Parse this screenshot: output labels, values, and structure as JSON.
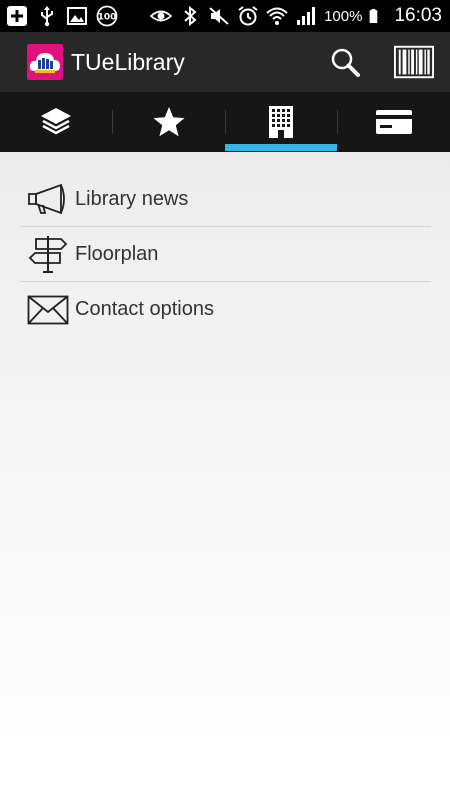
{
  "status_bar": {
    "battery_percent": "100%",
    "time": "16:03",
    "icons_left": [
      "add-icon",
      "usb-icon",
      "image-icon",
      "100-badge-icon"
    ],
    "icons_right": [
      "eye-icon",
      "bluetooth-icon",
      "mute-icon",
      "alarm-icon",
      "wifi-icon",
      "signal-icon",
      "battery-icon"
    ]
  },
  "action_bar": {
    "title": "TUeLibrary",
    "logo_color": "#e0117e",
    "actions": [
      "search-icon",
      "barcode-icon"
    ]
  },
  "tabs": {
    "items": [
      "layers-icon",
      "star-icon",
      "building-icon",
      "card-icon"
    ],
    "selected_index": 2,
    "indicator_color": "#33b5e5"
  },
  "menu": {
    "items": [
      {
        "label": "Library news",
        "icon": "megaphone-icon"
      },
      {
        "label": "Floorplan",
        "icon": "signpost-icon"
      },
      {
        "label": "Contact options",
        "icon": "envelope-icon"
      }
    ]
  }
}
